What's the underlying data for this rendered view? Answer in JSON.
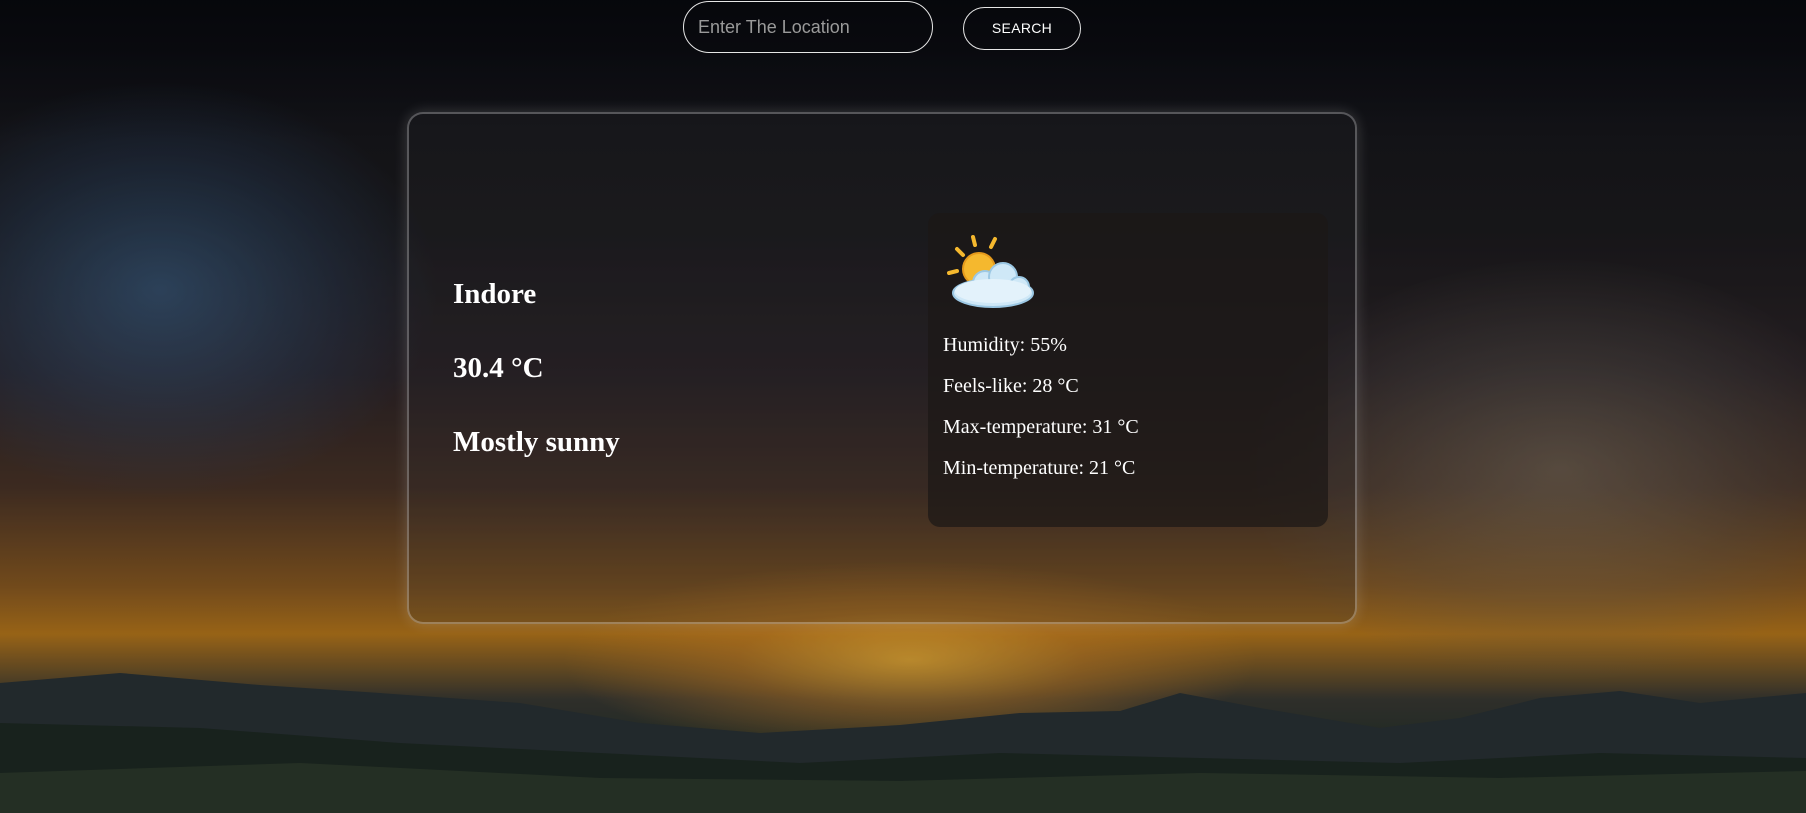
{
  "search": {
    "placeholder": "Enter The Location",
    "value": "",
    "button_label": "SEARCH"
  },
  "weather": {
    "city": "Indore",
    "temperature": "30.4 °C",
    "condition": "Mostly sunny",
    "icon": "sun-behind-cloud-icon",
    "details": {
      "humidity": "Humidity: 55%",
      "feels_like": "Feels-like: 28 °C",
      "max_temp": "Max-temperature: 31 °C",
      "min_temp": "Min-temperature: 21 °C"
    }
  },
  "colors": {
    "text": "#ffffff",
    "border": "#e6e6e6",
    "sun": "#f5b82e",
    "cloud": "#cfe8f7"
  }
}
